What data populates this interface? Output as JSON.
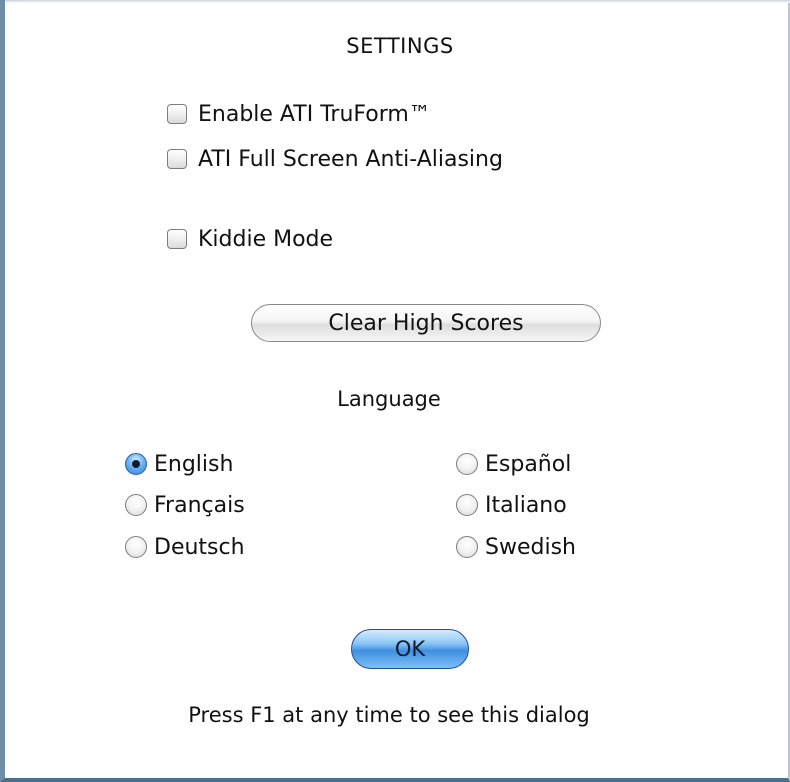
{
  "dialog": {
    "title": "SETTINGS",
    "checkboxes": [
      {
        "label": "Enable ATI TruForm™",
        "checked": false
      },
      {
        "label": "ATI Full Screen Anti-Aliasing",
        "checked": false
      },
      {
        "label": "Kiddie Mode",
        "checked": false
      }
    ],
    "clear_scores_label": "Clear High Scores",
    "language_heading": "Language",
    "languages": [
      {
        "label": "English",
        "selected": true
      },
      {
        "label": "Français",
        "selected": false
      },
      {
        "label": "Deutsch",
        "selected": false
      },
      {
        "label": "Español",
        "selected": false
      },
      {
        "label": "Italiano",
        "selected": false
      },
      {
        "label": "Swedish",
        "selected": false
      }
    ],
    "ok_label": "OK",
    "footer": "Press F1 at any time to see this dialog"
  },
  "colors": {
    "accent_blue": "#3f8fe0",
    "frame_blue": "#4d6f8e",
    "text": "#111111"
  }
}
